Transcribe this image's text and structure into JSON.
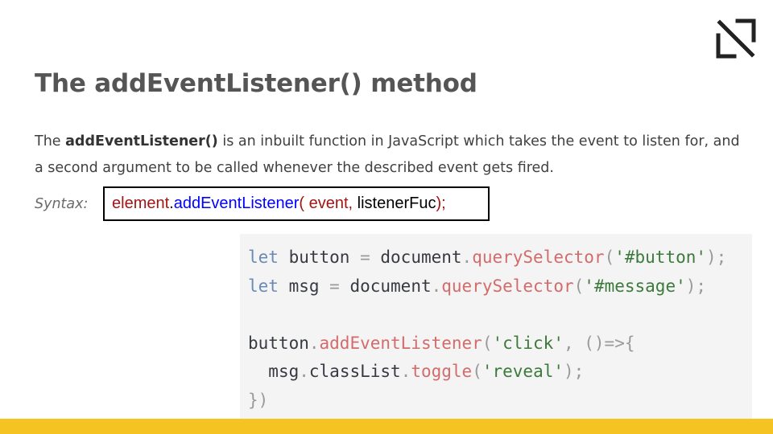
{
  "slide": {
    "title": "The addEventListener() method",
    "description": {
      "prefix": "The ",
      "bold": "addEventListener()",
      "suffix": " is an inbuilt function in JavaScript which takes the event to listen for, and a second argument to be called whenever the described event gets fired."
    },
    "syntax_label": "Syntax:",
    "syntax": {
      "object": "element",
      "dot": ".",
      "method": "addEventListener",
      "open": "( ",
      "arg1": "event",
      "comma": ", ",
      "arg2": "listenerFuc",
      "close": ");"
    }
  },
  "code": {
    "line1": {
      "kw": "let",
      "rest1": " button ",
      "eq": "=",
      "rest2": " document",
      "dot": ".",
      "fn": "querySelector",
      "open": "(",
      "str": "'#button'",
      "close": ");"
    },
    "line2": {
      "kw": "let",
      "rest1": " msg ",
      "eq": "=",
      "rest2": " document",
      "dot": ".",
      "fn": "querySelector",
      "open": "(",
      "str": "'#message'",
      "close": ");"
    },
    "line4": {
      "obj": "button",
      "dot": ".",
      "fn": "addEventListener",
      "open": "(",
      "str": "'click'",
      "mid": ", ()=>{"
    },
    "line5": {
      "indent": "  ",
      "obj": "msg",
      "dot1": ".",
      "prop": "classList",
      "dot2": ".",
      "fn": "toggle",
      "open": "(",
      "str": "'reveal'",
      "close": ");"
    },
    "line6": {
      "close": "})"
    }
  },
  "colors": {
    "accent_bar": "#f5c322",
    "code_background": "#f4f4f4",
    "keyword": "#6a8ab5",
    "function": "#d36b6b",
    "string": "#3c7a3c"
  },
  "icons": {
    "logo": "bracket-slash-logo-icon"
  }
}
